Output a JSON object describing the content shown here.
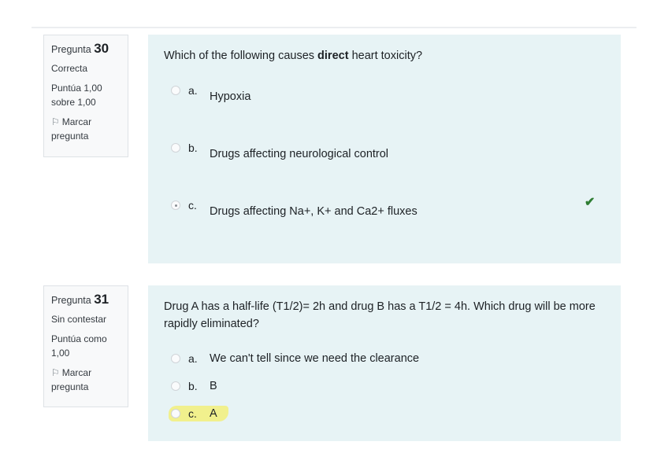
{
  "questions": [
    {
      "label": "Pregunta",
      "number": "30",
      "state": "Correcta",
      "grade": "Puntúa 1,00 sobre 1,00",
      "flag": "Marcar pregunta",
      "text_pre": "Which of the following causes ",
      "text_bold": "direct",
      "text_post": " heart toxicity?",
      "options": [
        {
          "letter": "a.",
          "text": "Hypoxia"
        },
        {
          "letter": "b.",
          "text": "Drugs affecting neurological control"
        },
        {
          "letter": "c.",
          "text": "Drugs affecting Na+, K+ and Ca2+ fluxes",
          "selected": true,
          "correct": true
        }
      ],
      "correct_icon": "check-icon"
    },
    {
      "label": "Pregunta",
      "number": "31",
      "state": "Sin contestar",
      "grade": "Puntúa como 1,00",
      "flag": "Marcar pregunta",
      "text": "Drug A has a half-life (T1/2)= 2h and drug B has a T1/2 = 4h. Which drug will be more rapidly eliminated?",
      "options": [
        {
          "letter": "a.",
          "text": "We can't tell since we need the clearance"
        },
        {
          "letter": "b.",
          "text": "B"
        },
        {
          "letter": "c.",
          "text": "A",
          "highlighted": true
        }
      ]
    }
  ],
  "colors": {
    "content_bg": "#e7f3f5",
    "info_bg": "#f8f9fa",
    "correct": "#2e7d32",
    "highlight": "#f2ef7a"
  }
}
